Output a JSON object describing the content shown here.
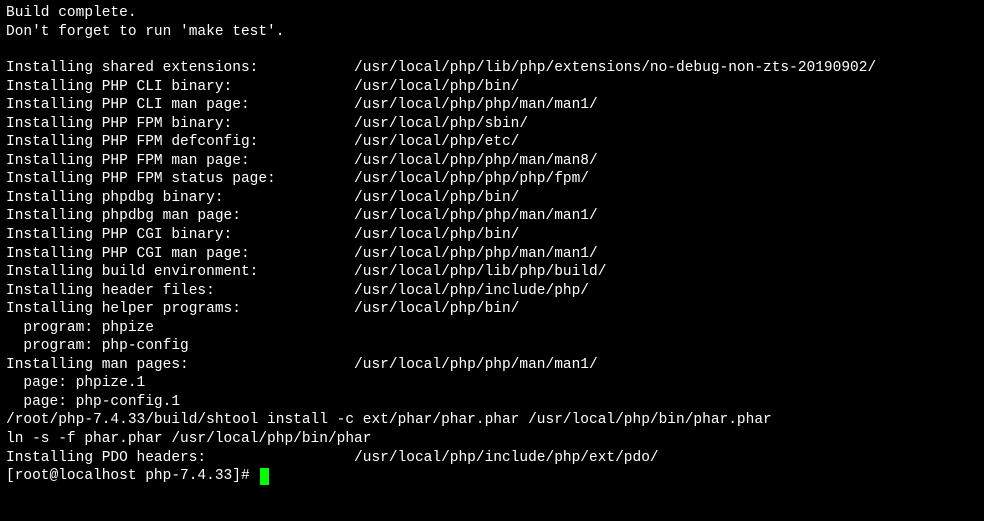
{
  "header": {
    "line1": "Build complete.",
    "line2": "Don't forget to run 'make test'."
  },
  "installs": [
    {
      "label": "Installing shared extensions:",
      "path": "/usr/local/php/lib/php/extensions/no-debug-non-zts-20190902/"
    },
    {
      "label": "Installing PHP CLI binary:",
      "path": "/usr/local/php/bin/"
    },
    {
      "label": "Installing PHP CLI man page:",
      "path": "/usr/local/php/php/man/man1/"
    },
    {
      "label": "Installing PHP FPM binary:",
      "path": "/usr/local/php/sbin/"
    },
    {
      "label": "Installing PHP FPM defconfig:",
      "path": "/usr/local/php/etc/"
    },
    {
      "label": "Installing PHP FPM man page:",
      "path": "/usr/local/php/php/man/man8/"
    },
    {
      "label": "Installing PHP FPM status page:",
      "path": "/usr/local/php/php/php/fpm/"
    },
    {
      "label": "Installing phpdbg binary:",
      "path": "/usr/local/php/bin/"
    },
    {
      "label": "Installing phpdbg man page:",
      "path": "/usr/local/php/php/man/man1/"
    },
    {
      "label": "Installing PHP CGI binary:",
      "path": "/usr/local/php/bin/"
    },
    {
      "label": "Installing PHP CGI man page:",
      "path": "/usr/local/php/php/man/man1/"
    },
    {
      "label": "Installing build environment:",
      "path": "/usr/local/php/lib/php/build/"
    },
    {
      "label": "Installing header files:",
      "path": "/usr/local/php/include/php/"
    },
    {
      "label": "Installing helper programs:",
      "path": "/usr/local/php/bin/"
    }
  ],
  "programs": [
    "  program: phpize",
    "  program: php-config"
  ],
  "man_pages_header": {
    "label": "Installing man pages:",
    "path": "/usr/local/php/php/man/man1/"
  },
  "pages": [
    "  page: phpize.1",
    "  page: php-config.1"
  ],
  "footer": {
    "shtool": "/root/php-7.4.33/build/shtool install -c ext/phar/phar.phar /usr/local/php/bin/phar.phar",
    "ln": "ln -s -f phar.phar /usr/local/php/bin/phar",
    "pdo": {
      "label": "Installing PDO headers:",
      "path": "/usr/local/php/include/php/ext/pdo/"
    }
  },
  "prompt": "[root@localhost php-7.4.33]# "
}
